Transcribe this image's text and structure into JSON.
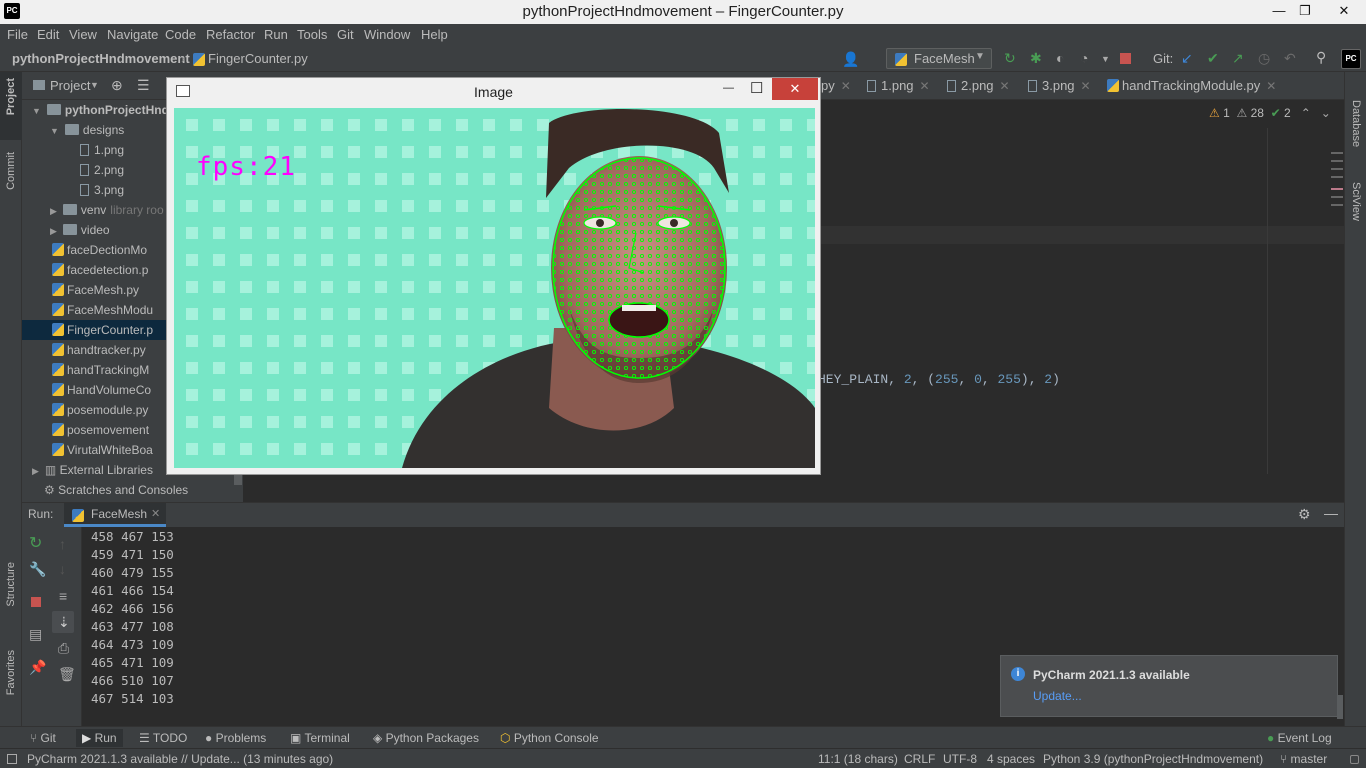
{
  "window": {
    "title": "pythonProjectHndmovement – FingerCounter.py",
    "minimize": "—",
    "maximize": "❐",
    "close": "✕"
  },
  "menu": [
    "File",
    "Edit",
    "View",
    "Navigate",
    "Code",
    "Refactor",
    "Run",
    "Tools",
    "Git",
    "Window",
    "Help"
  ],
  "nav": {
    "project": "pythonProjectHndmovement",
    "file": "FingerCounter.py",
    "run_config": "FaceMesh",
    "git_label": "Git:"
  },
  "left_strip": {
    "project": "Project",
    "commit": "Commit",
    "structure": "Structure",
    "favorites": "Favorites"
  },
  "right_strip": {
    "database": "Database",
    "sciview": "SciView"
  },
  "project_panel": {
    "header": "Project",
    "items": [
      {
        "label": "pythonProjectHnd",
        "kind": "folder",
        "depth": 0,
        "arrow": "down"
      },
      {
        "label": "designs",
        "kind": "folder",
        "depth": 1,
        "arrow": "down"
      },
      {
        "label": "1.png",
        "kind": "png",
        "depth": 2
      },
      {
        "label": "2.png",
        "kind": "png",
        "depth": 2
      },
      {
        "label": "3.png",
        "kind": "png",
        "depth": 2
      },
      {
        "label": "venv",
        "suffix": "library roo",
        "kind": "folder",
        "depth": 1,
        "arrow": "right"
      },
      {
        "label": "video",
        "kind": "folder",
        "depth": 1,
        "arrow": "right"
      },
      {
        "label": "faceDectionMo",
        "kind": "py",
        "depth": 1
      },
      {
        "label": "facedetection.p",
        "kind": "py",
        "depth": 1
      },
      {
        "label": "FaceMesh.py",
        "kind": "py",
        "depth": 1
      },
      {
        "label": "FaceMeshModu",
        "kind": "py",
        "depth": 1
      },
      {
        "label": "FingerCounter.p",
        "kind": "py",
        "depth": 1,
        "selected": true
      },
      {
        "label": "handtracker.py",
        "kind": "py",
        "depth": 1
      },
      {
        "label": "handTrackingM",
        "kind": "py",
        "depth": 1
      },
      {
        "label": "HandVolumeCo",
        "kind": "py",
        "depth": 1
      },
      {
        "label": "posemodule.py",
        "kind": "py",
        "depth": 1
      },
      {
        "label": "posemovement",
        "kind": "py",
        "depth": 1
      },
      {
        "label": "VirutalWhiteBoa",
        "kind": "py",
        "depth": 1
      },
      {
        "label": "External Libraries",
        "kind": "lib",
        "depth": 0,
        "arrow": "right"
      },
      {
        "label": "Scratches and Consoles",
        "kind": "scratch",
        "depth": 0
      }
    ]
  },
  "editor": {
    "tabs": [
      {
        "label": "py"
      },
      {
        "label": "1.png"
      },
      {
        "label": "2.png"
      },
      {
        "label": "3.png"
      },
      {
        "label": "handTrackingModule.py"
      }
    ],
    "inspections": {
      "warnings": "1",
      "weak_warnings": "28",
      "ok": "2"
    },
    "code_fragment": {
      "a": "HEY_PLAIN, ",
      "b": "2",
      "c": ", (",
      "d": "255",
      "e": ", ",
      "f": "0",
      "g": ", ",
      "h": "255",
      "i": "), ",
      "j": "2",
      "k": ")"
    }
  },
  "image_window": {
    "title": "Image",
    "minimize": "—",
    "maximize": "☐",
    "close": "✕",
    "fps_text": "fps:21"
  },
  "run": {
    "label": "Run:",
    "tab": "FaceMesh",
    "output": [
      "458 467 153",
      "459 471 150",
      "460 479 155",
      "461 466 154",
      "462 466 156",
      "463 477 108",
      "464 473 109",
      "465 471 109",
      "466 510 107",
      "467 514 103"
    ]
  },
  "notification": {
    "title": "PyCharm 2021.1.3 available",
    "link": "Update..."
  },
  "bottom_tools": [
    "Git",
    "Run",
    "TODO",
    "Problems",
    "Terminal",
    "Python Packages",
    "Python Console"
  ],
  "event_log": "Event Log",
  "status": {
    "message": "PyCharm 2021.1.3 available // Update... (13 minutes ago)",
    "position": "11:1 (18 chars)",
    "line_sep": "CRLF",
    "encoding": "UTF-8",
    "indent": "4 spaces",
    "interpreter": "Python 3.9 (pythonProjectHndmovement)",
    "branch": "master"
  },
  "colors": {
    "accent": "#4a88c7",
    "selection": "#0d293e",
    "mesh": "#00ff00",
    "fps": "#ff00ff",
    "stop": "#c75450",
    "run_green": "#499c54"
  }
}
